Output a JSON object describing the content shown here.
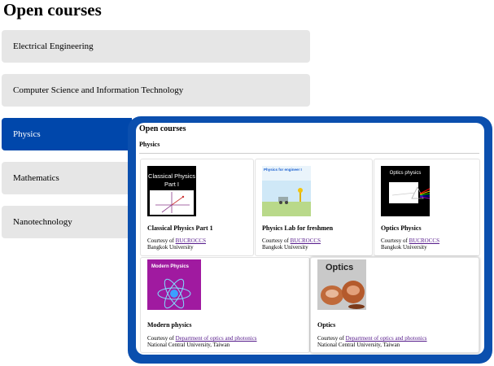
{
  "page": {
    "title": "Open courses"
  },
  "tabs": [
    {
      "label": "Electrical Engineering"
    },
    {
      "label": "Computer Science and Information Technology"
    },
    {
      "label": "Physics"
    },
    {
      "label": "Mathematics"
    },
    {
      "label": "Nanotechnology"
    }
  ],
  "active_tab": "Physics",
  "panel": {
    "title": "Open courses",
    "subtitle": "Physics",
    "courses": [
      {
        "title": "Classical Physics Part 1",
        "thumb_text": "Classical Physics Part I",
        "courtesy_prefix": "Courtesy of",
        "courtesy_link": "BUCROCCS",
        "institution": "Bangkok University"
      },
      {
        "title": "Physics Lab for freshmen",
        "thumb_text": "Physics for engineer I",
        "courtesy_prefix": "Courtesy of",
        "courtesy_link": "BUCROCCS",
        "institution": "Bangkok University"
      },
      {
        "title": "Optics Physics",
        "thumb_text": "Optics physics",
        "courtesy_prefix": "Courtesy of",
        "courtesy_link": "BUCROCCS",
        "institution": "Bangkok University"
      },
      {
        "title": "Modern physics",
        "thumb_text": "Modern Physics",
        "courtesy_prefix": "Courtesy of",
        "courtesy_link": "Department of optics and photonics",
        "institution": "National Central University, Taiwan"
      },
      {
        "title": "Optics",
        "thumb_text": "Optics",
        "courtesy_prefix": "Courtesy of",
        "courtesy_link": "Department of optics and photonics",
        "institution": "National Central University, Taiwan"
      }
    ]
  },
  "colors": {
    "active_tab": "#0047ab",
    "panel_border": "#0b4fae",
    "tab_bg": "#e6e6e6"
  }
}
